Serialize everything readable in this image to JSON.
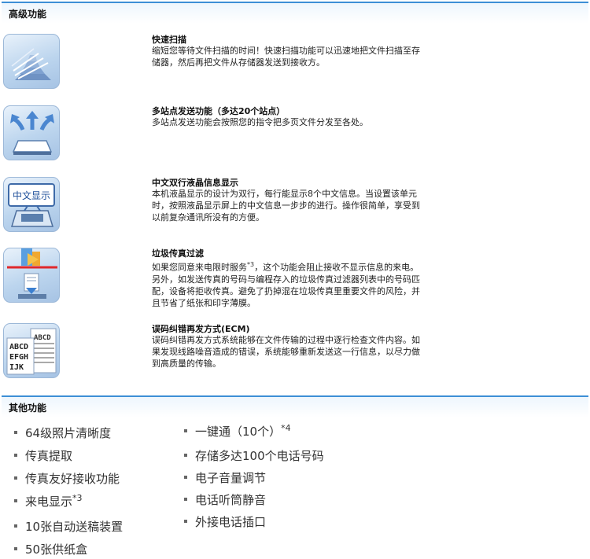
{
  "advanced_section": {
    "title": "高级功能",
    "features": [
      {
        "icon": "fast-scan-icon",
        "title": "快速扫描",
        "desc_lines": [
          "缩短您等待文件扫描的时间！快速扫描功能可以迅速地把文件扫描至存",
          "储器，然后再把文件从存储器发送到接收方。"
        ]
      },
      {
        "icon": "broadcast-icon",
        "title": "多站点发送功能（多达20个站点）",
        "desc_lines": [
          "多站点发送功能会按照您的指令把多页文件分发至各处。"
        ]
      },
      {
        "icon": "lcd-display-icon",
        "icon_text": "中文显示",
        "title": "中文双行液晶信息显示",
        "desc_lines": [
          "本机液晶显示的设计为双行，每行能显示8个中文信息。当设置该单元",
          "时，按照液晶显示屏上的中文信息一步步的进行。操作很简单，享受到",
          "以前复杂通讯所没有的方便。"
        ]
      },
      {
        "icon": "junk-fax-filter-icon",
        "title": "垃圾传真过滤",
        "desc_first": "如果您同意来电限时服务",
        "desc_sup": "*3",
        "desc_first_rest": "，这个功能会阻止接收不显示信息的来电。",
        "desc_lines": [
          "另外，如发送传真的号码与编程存入的垃圾传真过滤器列表中的号码匹",
          "配，设备将拒收传真。避免了扔掉混在垃圾传真里重要文件的风险，并",
          "且节省了纸张和印字薄膜。"
        ]
      },
      {
        "icon": "ecm-icon",
        "icon_text_lines": [
          "ABCD",
          "ABCD",
          "EFGH",
          "IJK"
        ],
        "title": "误码纠错再发方式(ECM)",
        "desc_lines": [
          "误码纠错再发方式系统能够在文件传输的过程中逐行检查文件内容。如",
          "果发现线路噪音造成的错误，系统能够重新发送这一行信息，以尽力做",
          "到高质量的传输。"
        ]
      }
    ]
  },
  "other_section": {
    "title": "其他功能",
    "left_items": [
      {
        "text": "64级照片清晰度",
        "sup": ""
      },
      {
        "text": "传真提取",
        "sup": ""
      },
      {
        "text": "传真友好接收功能",
        "sup": ""
      },
      {
        "text": "来电显示",
        "sup": "*3"
      },
      {
        "text": "10张自动送稿装置",
        "sup": ""
      },
      {
        "text": "50张供纸盒",
        "sup": ""
      }
    ],
    "right_items": [
      {
        "text": "一键通（10个）",
        "sup": "*4"
      },
      {
        "text": "存储多达100个电话号码",
        "sup": ""
      },
      {
        "text": "电子音量调节",
        "sup": ""
      },
      {
        "text": "电话听筒静音",
        "sup": ""
      },
      {
        "text": "外接电话插口",
        "sup": ""
      }
    ]
  }
}
